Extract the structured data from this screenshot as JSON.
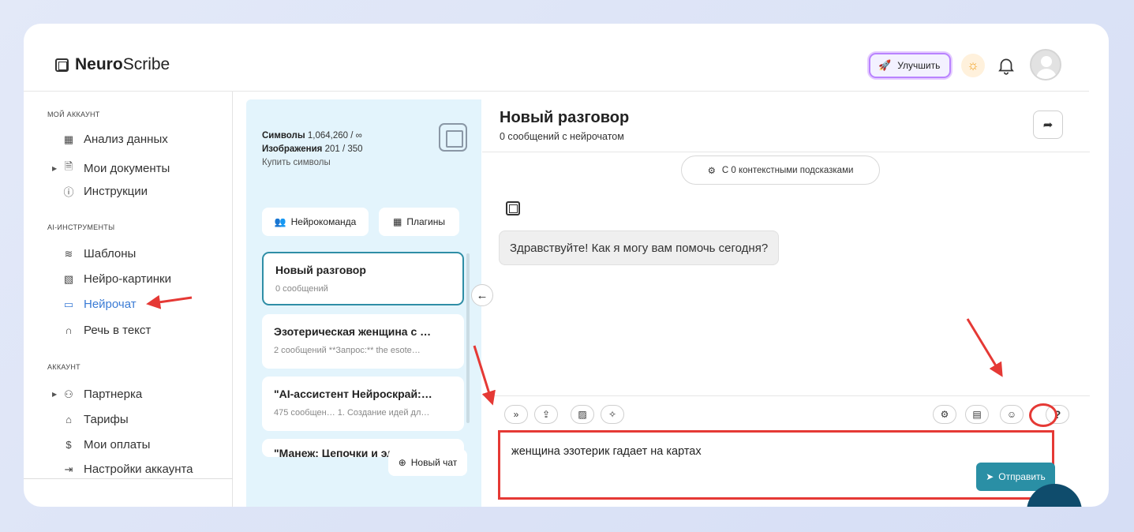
{
  "app": {
    "logo_bold": "Neuro",
    "logo_light": "Scribe",
    "upgrade_label": "Улучшить"
  },
  "sidebar": {
    "sections": [
      {
        "title": "МОЙ АККАУНТ",
        "items": [
          {
            "label": "Анализ данных",
            "icon": "grid-icon"
          },
          {
            "label": "Мои документы",
            "icon": "document-icon",
            "expandable": true
          },
          {
            "label": "Инструкции",
            "icon": "question-icon"
          }
        ]
      },
      {
        "title": "AI-ИНСТРУМЕНТЫ",
        "items": [
          {
            "label": "Шаблоны",
            "icon": "layers-icon"
          },
          {
            "label": "Нейро-картинки",
            "icon": "image-icon"
          },
          {
            "label": "Нейрочат",
            "icon": "chat-icon",
            "active": true
          },
          {
            "label": "Речь в текст",
            "icon": "headphones-icon"
          }
        ]
      },
      {
        "title": "АККАУНТ",
        "items": [
          {
            "label": "Партнерка",
            "icon": "users-icon",
            "expandable": true
          },
          {
            "label": "Тарифы",
            "icon": "tag-icon"
          },
          {
            "label": "Мои оплаты",
            "icon": "dollar-icon"
          },
          {
            "label": "Настройки аккаунта",
            "icon": "logout-icon"
          }
        ]
      }
    ]
  },
  "panel": {
    "symbols_label": "Символы",
    "symbols_value": "1,064,260 / ∞",
    "images_label": "Изображения",
    "images_value": "201 / 350",
    "buy_label": "Купить символы",
    "team_button": "Нейрокоманда",
    "plugins_button": "Плагины",
    "new_chat_button": "Новый чат",
    "chats": [
      {
        "title": "Новый разговор",
        "subtitle": "0 сообщений"
      },
      {
        "title": "Эзотерическая женщина с …",
        "subtitle": "2 сообщений   **Запрос:** the esote…"
      },
      {
        "title": "\"AI-ассистент Нейроскрай:…",
        "subtitle": "475 сообщен… 1. Создание идей дл…"
      },
      {
        "title": "\"Манеж: Цепочки и эле…",
        "subtitle": ""
      }
    ]
  },
  "chat": {
    "title": "Новый разговор",
    "subtitle": "0 сообщений с нейрочатом",
    "context_label": "С 0 контекстными подсказками",
    "greeting": "Здравствуйте! Как я могу вам помочь сегодня?",
    "input_value": "женщина эзотерик гадает на картах",
    "send_label": "Отправить",
    "help_label": "?"
  },
  "colors": {
    "accent": "#2a8fa5",
    "highlight": "#e53935",
    "panel_bg": "#e3f4fc",
    "active_link": "#3a7bd5"
  }
}
